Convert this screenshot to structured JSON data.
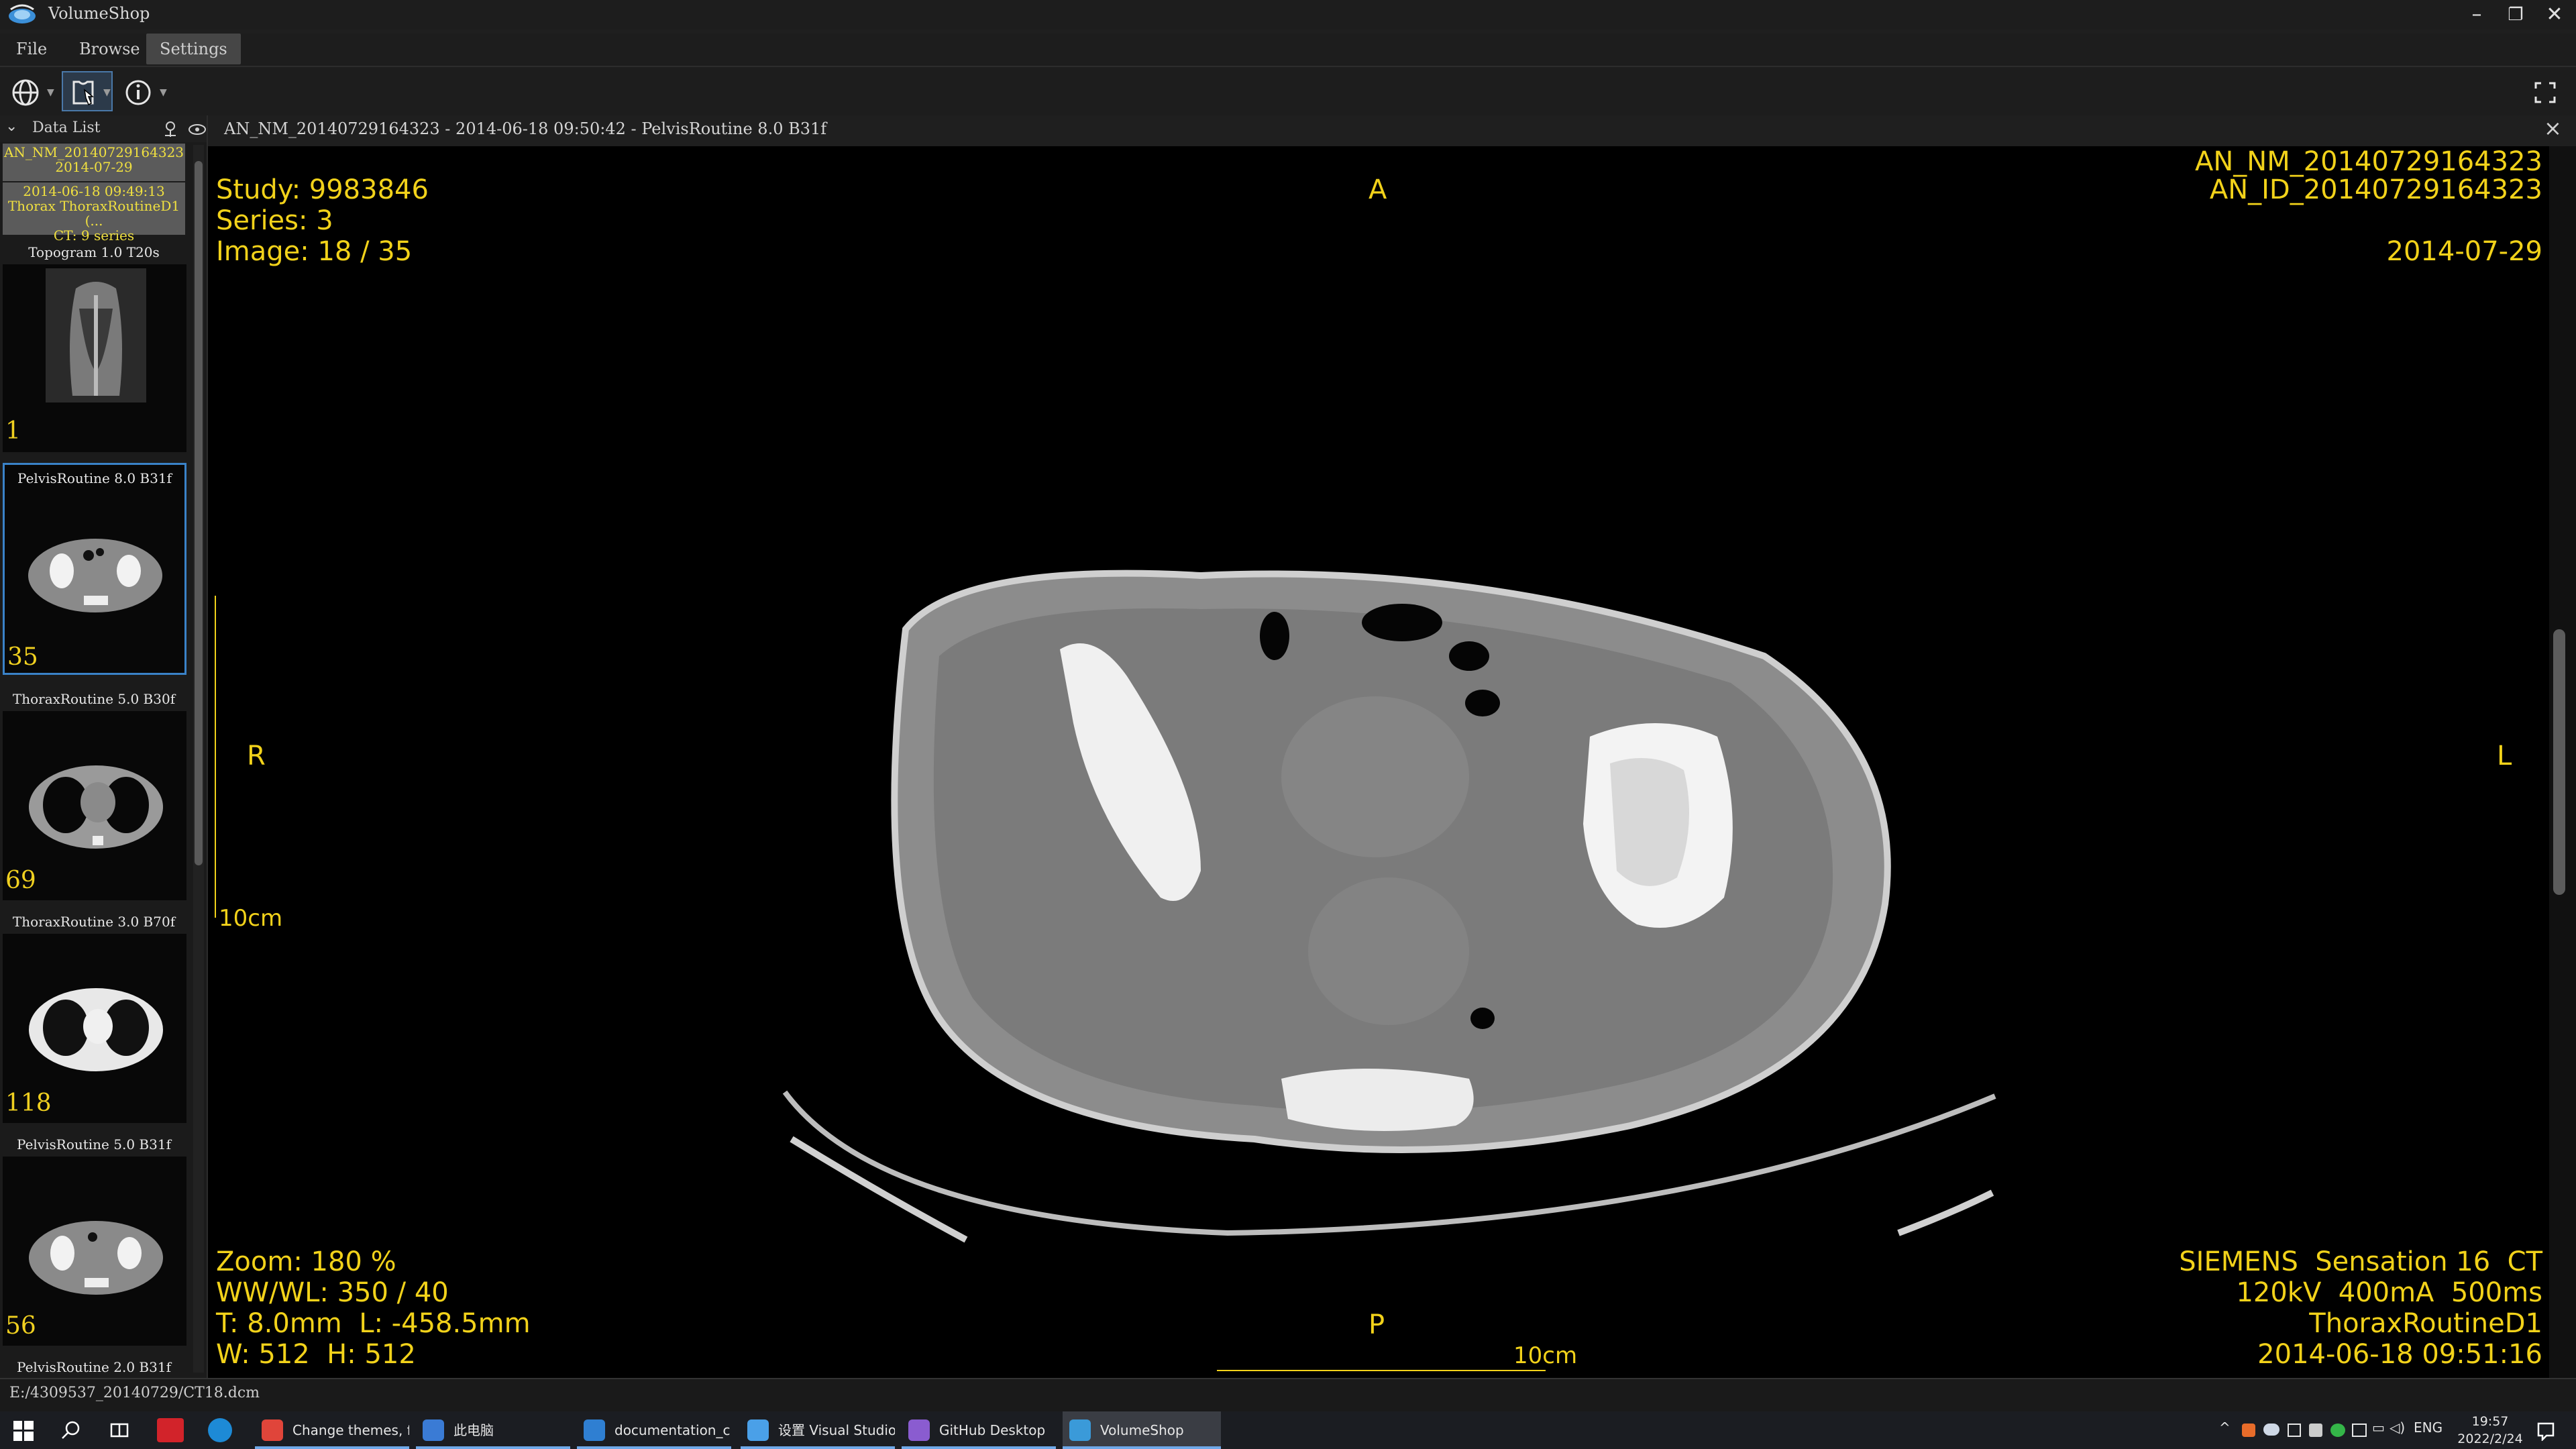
{
  "app": {
    "title": "VolumeShop"
  },
  "menu": {
    "file": "File",
    "browse": "Browse",
    "settings": "Settings"
  },
  "window": {
    "minimize": "–",
    "restore": "❐",
    "close": "✕"
  },
  "sidebar": {
    "header": "Data List",
    "patient": {
      "name": "AN_NM_20140729164323",
      "date": "2014-07-29"
    },
    "study": {
      "datetime": "2014-06-18  09:49:13",
      "desc": "Thorax ThoraxRoutineD1 (...",
      "series_count": "CT: 9 series"
    },
    "thumbnails": [
      {
        "title": "Topogram  1.0  T20s",
        "count": "1"
      },
      {
        "title": "PelvisRoutine  8.0  B31f",
        "count": "35"
      },
      {
        "title": "ThoraxRoutine  5.0  B30f",
        "count": "69"
      },
      {
        "title": "ThoraxRoutine  3.0  B70f",
        "count": "118"
      },
      {
        "title": "PelvisRoutine  5.0  B31f",
        "count": "56"
      },
      {
        "title": "PelvisRoutine  2.0  B31f",
        "count": ""
      }
    ]
  },
  "viewer": {
    "tab_title": "AN_NM_20140729164323 - 2014-06-18 09:50:42 - PelvisRoutine  8.0  B31f",
    "top_left": {
      "study": "Study: 9983846",
      "series": "Series: 3",
      "image": "Image: 18 / 35"
    },
    "top_right": {
      "name": "AN_NM_20140729164323",
      "id": "AN_ID_20140729164323",
      "date": "2014-07-29"
    },
    "orientation": {
      "top": "A",
      "bottom": "P",
      "left": "R",
      "right": "L"
    },
    "scale_left": "10cm",
    "scale_bottom": "10cm",
    "bottom_left": {
      "zoom": "Zoom: 180 %",
      "wwwl": "WW/WL: 350 / 40",
      "thickness": "T: 8.0mm  L: -458.5mm",
      "size": "W: 512  H: 512"
    },
    "bottom_right": {
      "device": "SIEMENS  Sensation 16  CT",
      "params": "120kV  400mA  500ms",
      "protocol": "ThoraxRoutineD1",
      "datetime": "2014-06-18 09:51:16"
    },
    "overlay_color": "#f2d21a"
  },
  "status": {
    "path": "E:/4309537_20140729/CT18.dcm"
  },
  "taskbar": {
    "items": [
      {
        "label": "Change themes, f...",
        "color": "#e0453a"
      },
      {
        "label": "此电脑",
        "color": "#3a7bd5"
      },
      {
        "label": "documentation_c...",
        "color": "#2f7fd2"
      },
      {
        "label": "设置 Visual Studio ...",
        "color": "#4aa0e8"
      },
      {
        "label": "GitHub Desktop",
        "color": "#8a5cd0"
      },
      {
        "label": "VolumeShop",
        "color": "#3a9ad9"
      }
    ],
    "lang": "ENG",
    "time": "19:57",
    "date": "2022/2/24"
  }
}
